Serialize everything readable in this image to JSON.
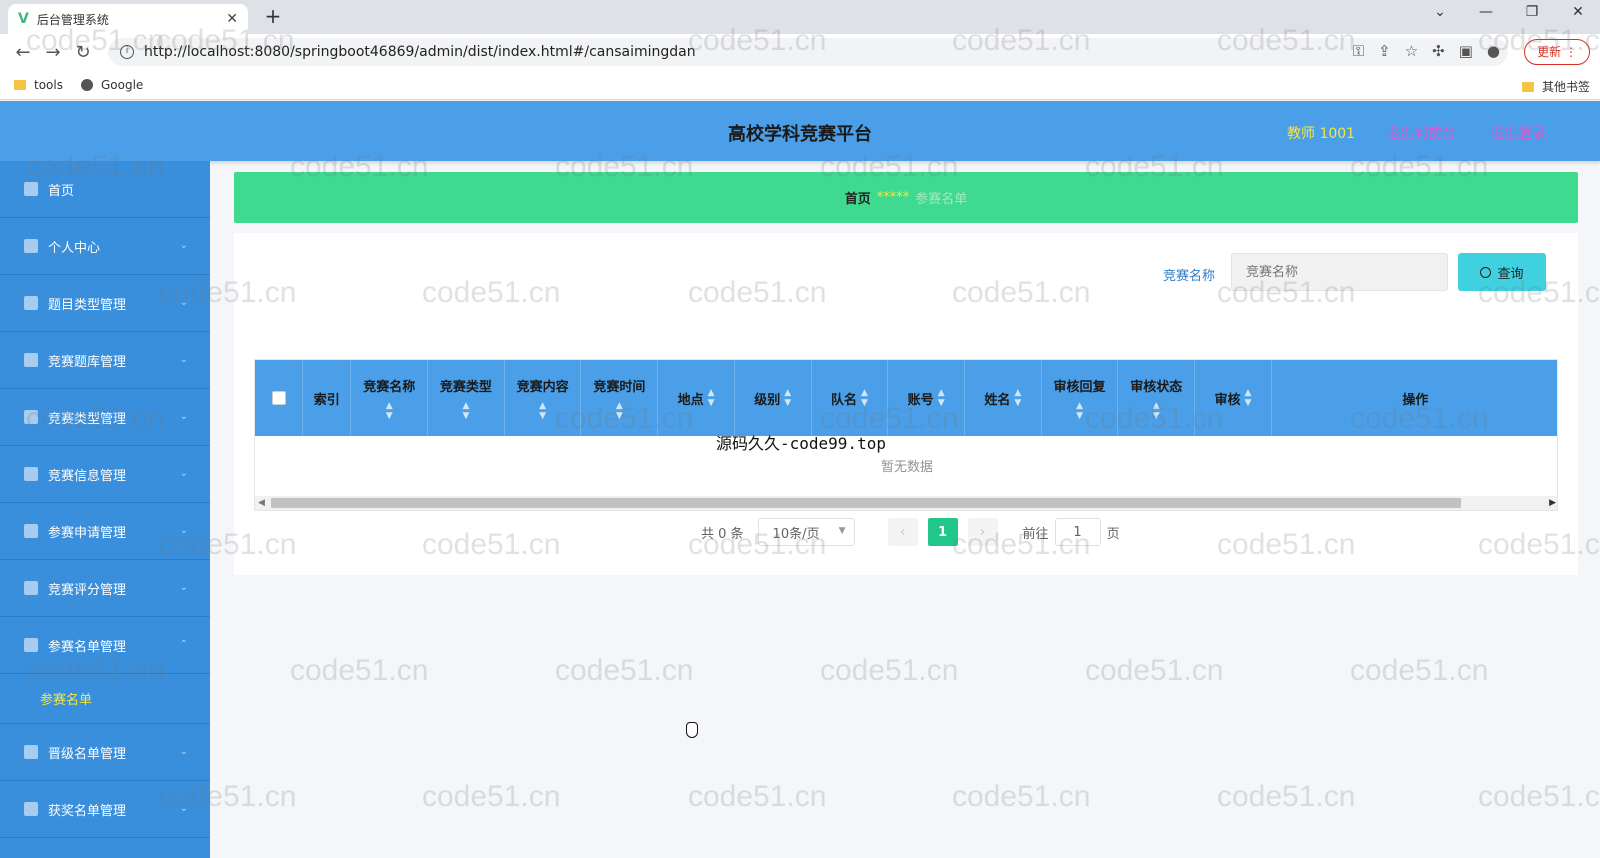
{
  "browser": {
    "tab_title": "后台管理系统",
    "tab_logo": "V",
    "new_tab": "+",
    "url": "http://localhost:8080/springboot46869/admin/dist/index.html#/cansaimingdan",
    "update_label": "更新",
    "bookmarks": [
      "tools",
      "Google"
    ],
    "other_bookmarks": "其他书签"
  },
  "header": {
    "title": "高校学科竞赛平台",
    "user": "教师 1001",
    "link_frontend": "退出到前台",
    "link_logout": "退出登录"
  },
  "sidebar": {
    "items": [
      {
        "label": "首页",
        "icon": "home-icon"
      },
      {
        "label": "个人中心",
        "icon": "user-icon"
      },
      {
        "label": "题目类型管理",
        "icon": "list-icon"
      },
      {
        "label": "竞赛题库管理",
        "icon": "book-icon"
      },
      {
        "label": "竞赛类型管理",
        "icon": "folder-icon"
      },
      {
        "label": "竞赛信息管理",
        "icon": "info-icon"
      },
      {
        "label": "参赛申请管理",
        "icon": "form-icon"
      },
      {
        "label": "竞赛评分管理",
        "icon": "grid-icon"
      },
      {
        "label": "参赛名单管理",
        "icon": "send-icon"
      },
      {
        "label": "晋级名单管理",
        "icon": "clock-icon"
      },
      {
        "label": "获奖名单管理",
        "icon": "phone-icon"
      }
    ],
    "sub_item": "参赛名单"
  },
  "breadcrumb": {
    "home": "首页",
    "sep": "*****",
    "current": "参赛名单"
  },
  "search": {
    "label": "竞赛名称",
    "placeholder": "竞赛名称",
    "button": "查询"
  },
  "table": {
    "columns": [
      "索引",
      "竞赛名称",
      "竞赛类型",
      "竞赛内容",
      "竞赛时间",
      "地点",
      "级别",
      "队名",
      "账号",
      "姓名",
      "审核回复",
      "审核状态",
      "审核",
      "操作"
    ],
    "empty_text": "暂无数据"
  },
  "pagination": {
    "total": "共 0 条",
    "page_size": "10条/页",
    "current_page": "1",
    "goto_label": "前往",
    "goto_value": "1",
    "page_suffix": "页"
  },
  "overlay_text": "源码久久-code99.top",
  "watermark": "code51.cn"
}
